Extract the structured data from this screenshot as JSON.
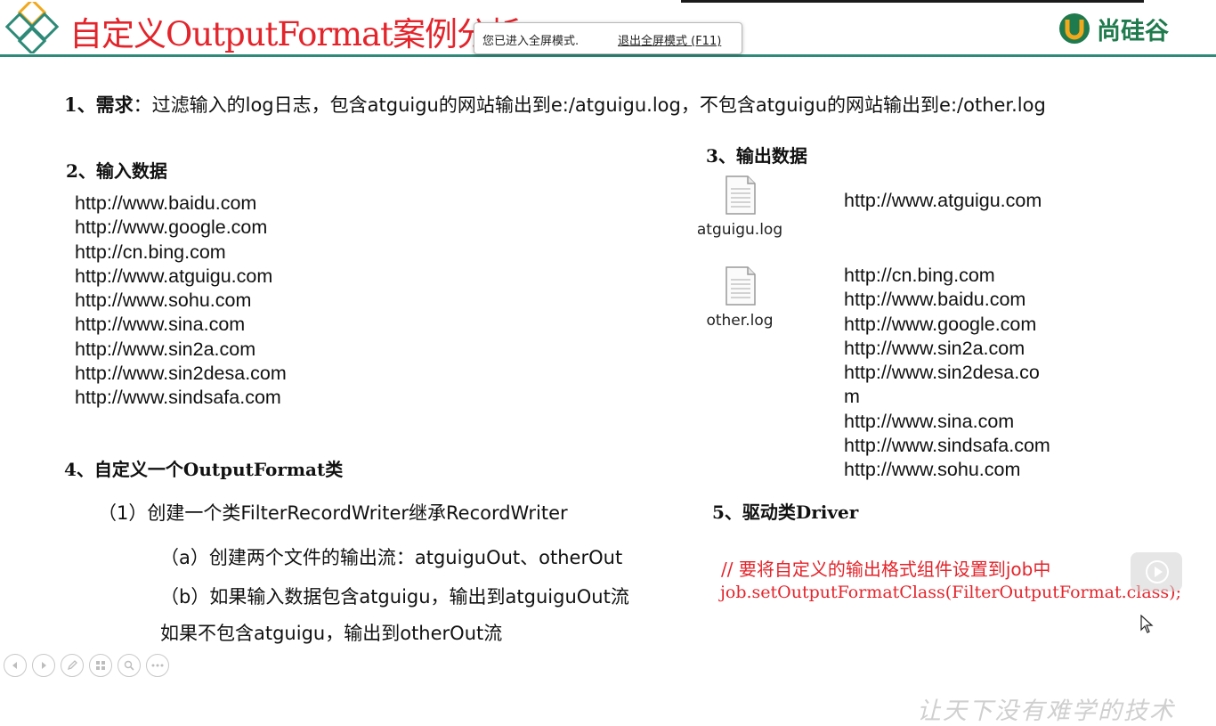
{
  "header": {
    "title": "自定义OutputFormat案例分析",
    "brand_text": "尚硅谷",
    "colors": {
      "title": "#e3242b",
      "rule": "#2e8a78",
      "brand": "#1f7a4d"
    }
  },
  "fullscreen_notice": {
    "message": "您已进入全屏模式.",
    "exit_link": "退出全屏模式 (F11)"
  },
  "slide": {
    "requirement": {
      "number": "1、需求",
      "text": "：过滤输入的log日志，包含atguigu的网站输出到e:/atguigu.log，不包含atguigu的网站输出到e:/other.log"
    },
    "input_section": {
      "heading": "2、输入数据",
      "urls": [
        "http://www.baidu.com",
        "http://www.google.com",
        "http://cn.bing.com",
        "http://www.atguigu.com",
        "http://www.sohu.com",
        "http://www.sina.com",
        "http://www.sin2a.com",
        "http://www.sin2desa.com",
        "http://www.sindsafa.com"
      ]
    },
    "output_section": {
      "heading": "3、输出数据",
      "files": [
        {
          "name": "atguigu.log",
          "icon": "document-icon",
          "urls": [
            "http://www.atguigu.com"
          ]
        },
        {
          "name": "other.log",
          "icon": "document-icon",
          "urls": [
            "http://cn.bing.com",
            "http://www.baidu.com",
            "http://www.google.com",
            "http://www.sin2a.com",
            "http://www.sin2desa.co",
            "m",
            "http://www.sina.com",
            "http://www.sindsafa.com",
            "http://www.sohu.com"
          ]
        }
      ]
    },
    "custom_format_section": {
      "heading": "4、自定义一个OutputFormat类",
      "step1": "（1）创建一个类FilterRecordWriter继承RecordWriter",
      "step_a": "（a）创建两个文件的输出流：atguiguOut、otherOut",
      "step_b": "（b）如果输入数据包含atguigu，输出到atguiguOut流",
      "step_b2": "如果不包含atguigu，输出到otherOut流"
    },
    "driver_section": {
      "heading": "5、驱动类Driver",
      "comment": "//  要将自定义的输出格式组件设置到job中",
      "code": "job.setOutputFormatClass(FilterOutputFormat.class);"
    },
    "watermark": "让天下没有难学的技术"
  },
  "slide_controls": [
    "previous-icon",
    "next-icon",
    "pen-icon",
    "slides-icon",
    "zoom-icon",
    "more-icon"
  ]
}
